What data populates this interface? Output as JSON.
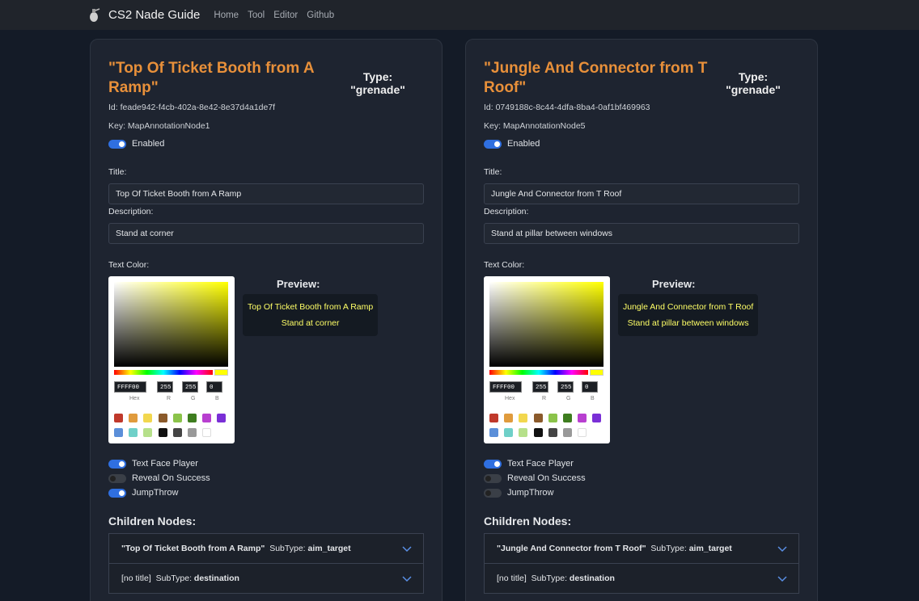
{
  "navbar": {
    "brand": "CS2 Nade Guide",
    "links": [
      "Home",
      "Tool",
      "Editor",
      "Github"
    ]
  },
  "cards": [
    {
      "title": "\"Top Of Ticket Booth from A Ramp\"",
      "type_label": "Type:",
      "type_value": "\"grenade\"",
      "id": "Id: feade942-f4cb-402a-8e42-8e37d4a1de7f",
      "key": "Key: MapAnnotationNode1",
      "enabled_label": "Enabled",
      "title_label": "Title:",
      "title_value": "Top Of Ticket Booth from A Ramp",
      "description_label": "Description:",
      "description_value": "Stand at corner",
      "text_color_label": "Text Color:",
      "picker": {
        "hex": "FFFF00",
        "r": "255",
        "g": "255",
        "b": "0",
        "hex_label": "Hex",
        "r_label": "R",
        "g_label": "G",
        "b_label": "B"
      },
      "preview_label": "Preview:",
      "preview_title": "Top Of Ticket Booth from A Ramp",
      "preview_desc": "Stand at corner",
      "toggles": [
        {
          "label": "Text Face Player",
          "on": true
        },
        {
          "label": "Reveal On Success",
          "on": false
        },
        {
          "label": "JumpThrow",
          "on": true
        }
      ],
      "children_label": "Children Nodes:",
      "children": [
        {
          "name": "\"Top Of Ticket Booth from A Ramp\"",
          "subtype_label": "SubType:",
          "subtype": "aim_target"
        },
        {
          "name": "[no title]",
          "subtype_label": "SubType:",
          "subtype": "destination"
        }
      ]
    },
    {
      "title": "\"Jungle And Connector from T Roof\"",
      "type_label": "Type:",
      "type_value": "\"grenade\"",
      "id": "Id: 0749188c-8c44-4dfa-8ba4-0af1bf469963",
      "key": "Key: MapAnnotationNode5",
      "enabled_label": "Enabled",
      "title_label": "Title:",
      "title_value": "Jungle And Connector from T Roof",
      "description_label": "Description:",
      "description_value": "Stand at pillar between windows",
      "text_color_label": "Text Color:",
      "picker": {
        "hex": "FFFF00",
        "r": "255",
        "g": "255",
        "b": "0",
        "hex_label": "Hex",
        "r_label": "R",
        "g_label": "G",
        "b_label": "B"
      },
      "preview_label": "Preview:",
      "preview_title": "Jungle And Connector from T Roof",
      "preview_desc": "Stand at pillar between windows",
      "toggles": [
        {
          "label": "Text Face Player",
          "on": true
        },
        {
          "label": "Reveal On Success",
          "on": false
        },
        {
          "label": "JumpThrow",
          "on": false
        }
      ],
      "children_label": "Children Nodes:",
      "children": [
        {
          "name": "\"Jungle And Connector from T Roof\"",
          "subtype_label": "SubType:",
          "subtype": "aim_target"
        },
        {
          "name": "[no title]",
          "subtype_label": "SubType:",
          "subtype": "destination"
        }
      ]
    }
  ],
  "swatch_colors": [
    "#c0392b",
    "#e09b3d",
    "#f2d74e",
    "#8b5a2b",
    "#8bc34a",
    "#3e7d1f",
    "#b83fd0",
    "#7a2fd6",
    "#5b8fd9",
    "#6fd0c8",
    "#b6e08a",
    "#111111",
    "#444444",
    "#999999",
    "#ffffff"
  ],
  "accent_color": "#e8903a"
}
